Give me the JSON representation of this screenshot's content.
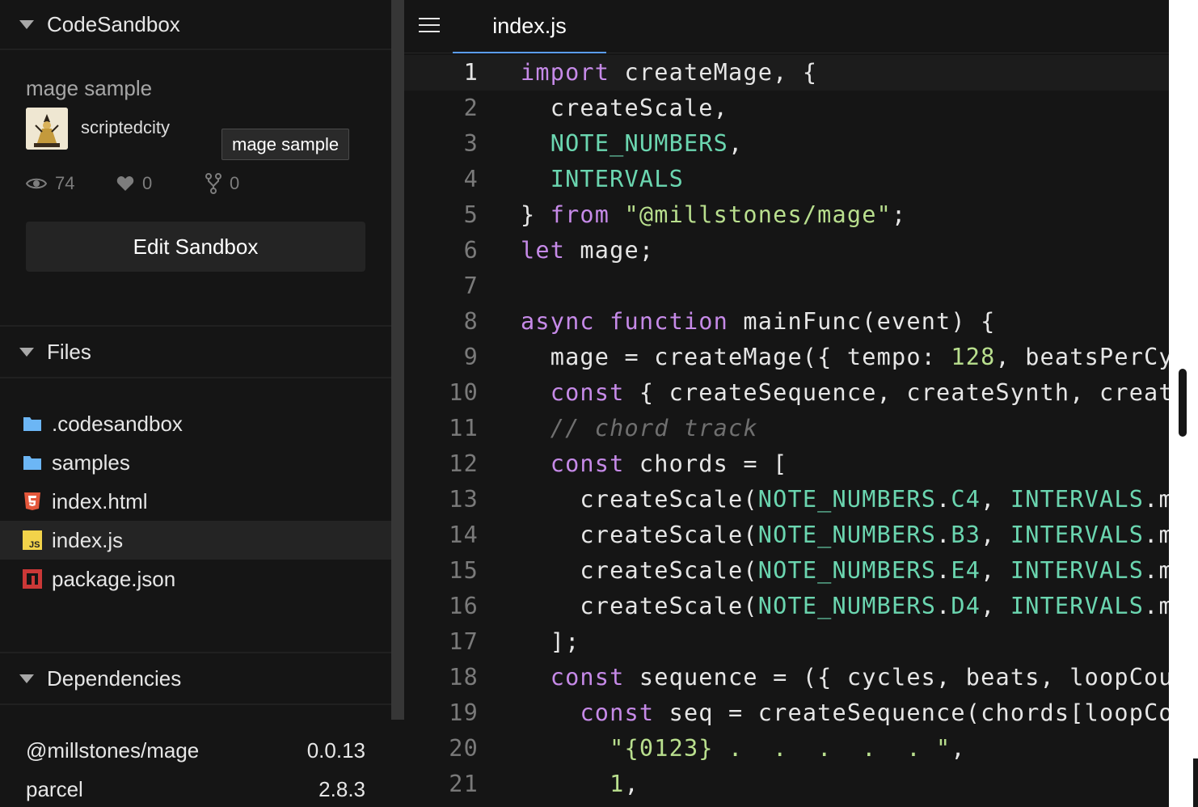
{
  "sidebar": {
    "header_title": "CodeSandbox",
    "sandbox": {
      "title": "mage sample",
      "author": "scriptedcity",
      "tooltip": "mage sample",
      "views": "74",
      "likes": "0",
      "forks": "0",
      "edit_label": "Edit Sandbox"
    },
    "files_title": "Files",
    "files": [
      {
        "name": ".codesandbox",
        "icon": "folder-icon"
      },
      {
        "name": "samples",
        "icon": "folder-icon"
      },
      {
        "name": "index.html",
        "icon": "html5-icon"
      },
      {
        "name": "index.js",
        "icon": "js-icon"
      },
      {
        "name": "package.json",
        "icon": "npm-icon"
      }
    ],
    "dependencies_title": "Dependencies",
    "dependencies": [
      {
        "name": "@millstones/mage",
        "version": "0.0.13"
      },
      {
        "name": "parcel",
        "version": "2.8.3"
      }
    ]
  },
  "editor": {
    "tab_label": "index.js",
    "current_line": 1,
    "lines": [
      [
        [
          "k",
          "import"
        ],
        [
          "t",
          " createMage, {"
        ]
      ],
      [
        [
          "t",
          "  createScale,"
        ]
      ],
      [
        [
          "t",
          "  "
        ],
        [
          "c",
          "NOTE_NUMBERS"
        ],
        [
          "t",
          ","
        ]
      ],
      [
        [
          "t",
          "  "
        ],
        [
          "c",
          "INTERVALS"
        ]
      ],
      [
        [
          "t",
          "} "
        ],
        [
          "k",
          "from"
        ],
        [
          "t",
          " "
        ],
        [
          "s",
          "\"@millstones/mage\""
        ],
        [
          "t",
          ";"
        ]
      ],
      [
        [
          "k",
          "let"
        ],
        [
          "t",
          " mage;"
        ]
      ],
      [
        [
          "t",
          ""
        ]
      ],
      [
        [
          "k",
          "async"
        ],
        [
          "t",
          " "
        ],
        [
          "k",
          "function"
        ],
        [
          "t",
          " mainFunc(event) {"
        ]
      ],
      [
        [
          "t",
          "  mage = createMage({ tempo: "
        ],
        [
          "n",
          "128"
        ],
        [
          "t",
          ", beatsPerCyc"
        ]
      ],
      [
        [
          "t",
          "  "
        ],
        [
          "k",
          "const"
        ],
        [
          "t",
          " { createSequence, createSynth, create"
        ]
      ],
      [
        [
          "t",
          "  "
        ],
        [
          "cm",
          "// chord track"
        ]
      ],
      [
        [
          "t",
          "  "
        ],
        [
          "k",
          "const"
        ],
        [
          "t",
          " chords = ["
        ]
      ],
      [
        [
          "t",
          "    createScale("
        ],
        [
          "c",
          "NOTE_NUMBERS"
        ],
        [
          "t",
          "."
        ],
        [
          "c",
          "C4"
        ],
        [
          "t",
          ", "
        ],
        [
          "c",
          "INTERVALS"
        ],
        [
          "t",
          ".ma"
        ]
      ],
      [
        [
          "t",
          "    createScale("
        ],
        [
          "c",
          "NOTE_NUMBERS"
        ],
        [
          "t",
          "."
        ],
        [
          "c",
          "B3"
        ],
        [
          "t",
          ", "
        ],
        [
          "c",
          "INTERVALS"
        ],
        [
          "t",
          ".mi"
        ]
      ],
      [
        [
          "t",
          "    createScale("
        ],
        [
          "c",
          "NOTE_NUMBERS"
        ],
        [
          "t",
          "."
        ],
        [
          "c",
          "E4"
        ],
        [
          "t",
          ", "
        ],
        [
          "c",
          "INTERVALS"
        ],
        [
          "t",
          ".mi"
        ]
      ],
      [
        [
          "t",
          "    createScale("
        ],
        [
          "c",
          "NOTE_NUMBERS"
        ],
        [
          "t",
          "."
        ],
        [
          "c",
          "D4"
        ],
        [
          "t",
          ", "
        ],
        [
          "c",
          "INTERVALS"
        ],
        [
          "t",
          ".mi"
        ]
      ],
      [
        [
          "t",
          "  ];"
        ]
      ],
      [
        [
          "t",
          "  "
        ],
        [
          "k",
          "const"
        ],
        [
          "t",
          " sequence = ({ cycles, beats, loopCoun"
        ]
      ],
      [
        [
          "t",
          "    "
        ],
        [
          "k",
          "const"
        ],
        [
          "t",
          " seq = createSequence(chords[loopCou"
        ]
      ],
      [
        [
          "t",
          "      "
        ],
        [
          "s",
          "\"{0123} .  .  .  .  . \""
        ],
        [
          "t",
          ","
        ]
      ],
      [
        [
          "t",
          "      "
        ],
        [
          "n",
          "1"
        ],
        [
          "t",
          ","
        ]
      ]
    ]
  }
}
